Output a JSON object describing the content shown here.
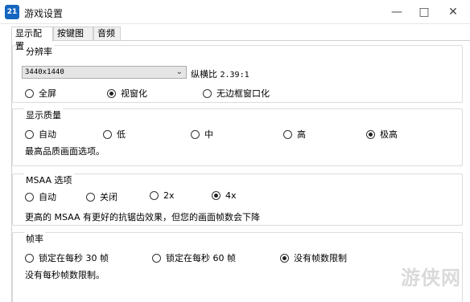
{
  "window": {
    "app_icon_text": "21",
    "title": "游戏设置",
    "min_icon": "minimize-icon",
    "max_icon": "maximize-icon",
    "close_icon": "close-icon"
  },
  "tabs": [
    {
      "label": "显示配置",
      "active": true
    },
    {
      "label": "按键图标",
      "active": false
    },
    {
      "label": "音频",
      "active": false
    }
  ],
  "resolution": {
    "group_label": "分辨率",
    "selected": "3440x1440",
    "aspect_label": "纵横比",
    "aspect_value": "2.39:1",
    "modes": [
      {
        "label": "全屏",
        "checked": false
      },
      {
        "label": "视窗化",
        "checked": true
      },
      {
        "label": "无边框窗口化",
        "checked": false
      }
    ]
  },
  "quality": {
    "group_label": "显示质量",
    "options": [
      {
        "label": "自动",
        "checked": false
      },
      {
        "label": "低",
        "checked": false
      },
      {
        "label": "中",
        "checked": false
      },
      {
        "label": "高",
        "checked": false
      },
      {
        "label": "极高",
        "checked": true
      }
    ],
    "description": "最高品质画面选项。"
  },
  "msaa": {
    "group_label": "MSAA 选项",
    "options": [
      {
        "label": "自动",
        "checked": false
      },
      {
        "label": "关闭",
        "checked": false
      },
      {
        "label": "2x",
        "checked": false
      },
      {
        "label": "4x",
        "checked": true
      }
    ],
    "description": "更高的 MSAA 有更好的抗锯齿效果，但您的画面帧数会下降"
  },
  "framerate": {
    "group_label": "帧率",
    "options": [
      {
        "label": "锁定在每秒 30 帧",
        "checked": false
      },
      {
        "label": "锁定在每秒 60 帧",
        "checked": false
      },
      {
        "label": "没有帧数限制",
        "checked": true
      }
    ],
    "description": "没有每秒帧数限制。"
  },
  "watermark": "游侠网"
}
